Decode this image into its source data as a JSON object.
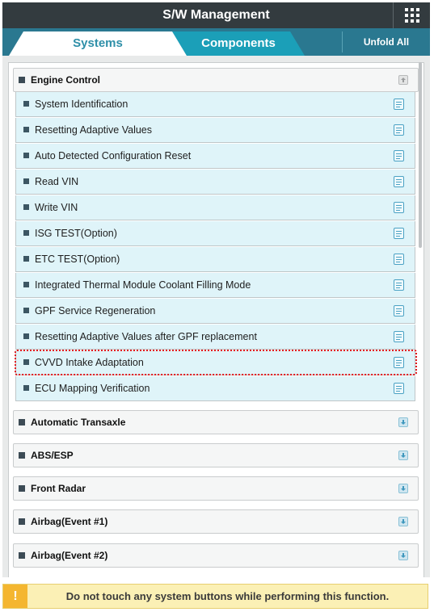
{
  "header": {
    "title": "S/W Management",
    "menu_icon": "grid-menu-icon"
  },
  "tabs": {
    "systems": "Systems",
    "components": "Components",
    "unfold_all": "Unfold All"
  },
  "colors": {
    "header_bg": "#333b3f",
    "tab_bar": "#2a7890",
    "active_tab_text": "#2e8fa8",
    "inactive_tab": "#1b9fb8",
    "item_bg": "#dff4f9",
    "highlight": "#e0191e",
    "warning_bg": "#fbf0b5",
    "warning_icon": "#f4b630"
  },
  "groups": [
    {
      "label": "Engine Control",
      "expanded": true
    },
    {
      "label": "Automatic Transaxle",
      "expanded": false
    },
    {
      "label": "ABS/ESP",
      "expanded": false
    },
    {
      "label": "Front Radar",
      "expanded": false
    },
    {
      "label": "Airbag(Event #1)",
      "expanded": false
    },
    {
      "label": "Airbag(Event #2)",
      "expanded": false
    }
  ],
  "engine_items": [
    "System Identification",
    "Resetting Adaptive Values",
    "Auto Detected Configuration Reset",
    "Read VIN",
    "Write VIN",
    "ISG TEST(Option)",
    "ETC TEST(Option)",
    "Integrated Thermal Module Coolant Filling Mode",
    "GPF Service Regeneration",
    "Resetting Adaptive Values after GPF replacement",
    "CVVD Intake Adaptation",
    "ECU Mapping Verification"
  ],
  "highlighted_item": "CVVD Intake Adaptation",
  "warning": {
    "icon": "!",
    "text": "Do not touch any system buttons while performing this function."
  }
}
